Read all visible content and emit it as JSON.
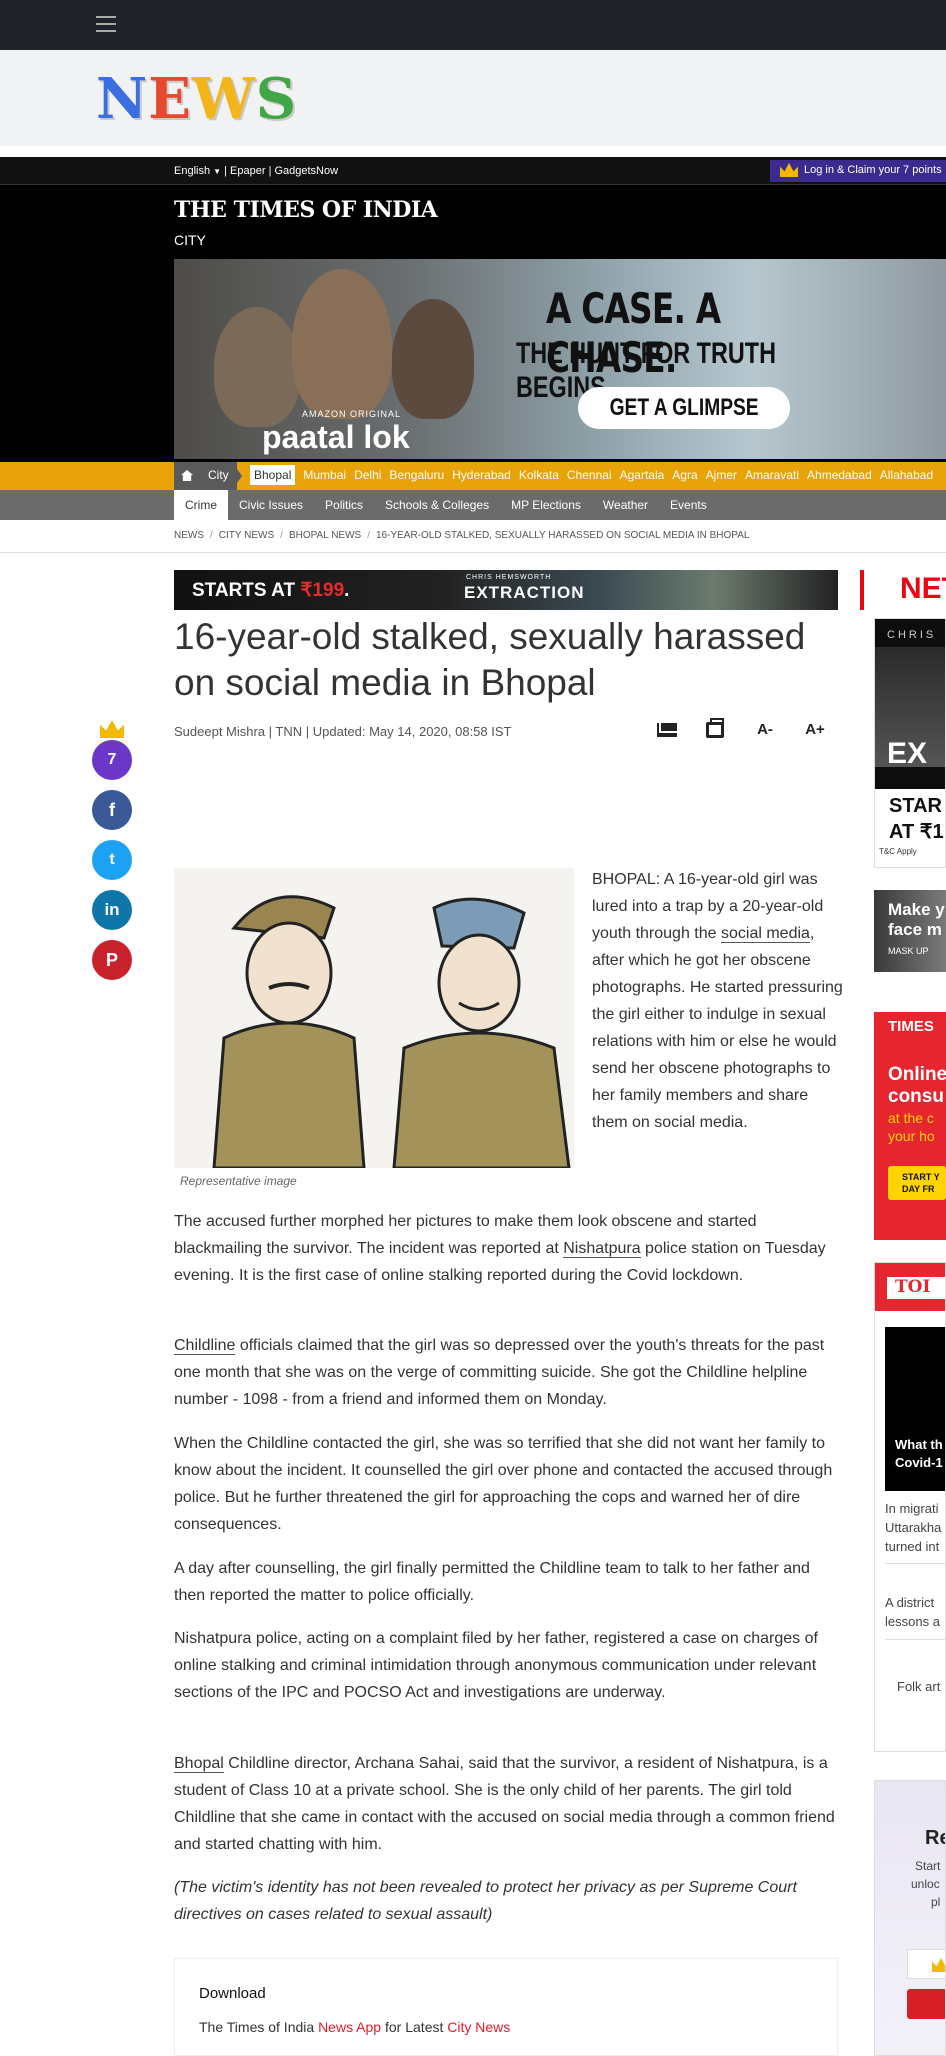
{
  "news_logo": {
    "n": "N",
    "e": "E",
    "w": "W",
    "s": "S"
  },
  "toi_header": {
    "language": "English",
    "links": "| Epaper | GadgetsNow",
    "login": "Log in & Claim your 7 points",
    "brand": "THE TIMES OF INDIA",
    "section": "CITY"
  },
  "banner": {
    "amazon": "AMAZON ORIGINAL",
    "show": "paatal lok",
    "headline": "A CASE. A CHASE.",
    "subhead": "THE HUNT FOR TRUTH BEGINS",
    "cta": "GET A GLIMPSE"
  },
  "city_nav": {
    "label": "City",
    "items": [
      "Bhopal",
      "Mumbai",
      "Delhi",
      "Bengaluru",
      "Hyderabad",
      "Kolkata",
      "Chennai",
      "Agartala",
      "Agra",
      "Ajmer",
      "Amaravati",
      "Ahmedabad",
      "Allahabad"
    ]
  },
  "sub_nav": {
    "items": [
      "Crime",
      "Civic Issues",
      "Politics",
      "Schools & Colleges",
      "MP Elections",
      "Weather",
      "Events"
    ]
  },
  "breadcrumb": [
    "NEWS",
    "CITY NEWS",
    "BHOPAL NEWS",
    "16-YEAR-OLD STALKED, SEXUALLY HARASSED ON SOCIAL MEDIA IN BHOPAL"
  ],
  "ad_strip": {
    "starts": "STARTS AT ",
    "price": "₹199",
    "dot": ".",
    "chris": "CHRIS HEMSWORTH",
    "movie": "EXTRACTION",
    "net": "NET"
  },
  "article": {
    "title": "16-year-old stalked, sexually harassed on social media in Bhopal",
    "byline": "Sudeept Mishra | TNN | Updated: May 14, 2020, 08:58 IST",
    "font_minus": "A-",
    "font_plus": "A+",
    "caption": "Representative image",
    "lead_1": "BHOPAL: A 16-year-old girl was lured into a trap by a 20-year-old youth through the ",
    "lead_link": "social media",
    "lead_2": ", after which he got her obscene photographs. He started pressuring the girl either to indulge in sexual relations with him or else he would send her obscene photographs to her family members and share them on social media.",
    "p1_a": "The accused further morphed her pictures to make them look obscene and started blackmailing the survivor. The incident was reported at ",
    "p1_link": "Nishatpura",
    "p1_b": " police station on Tuesday evening. It is the first case of online stalking reported during the Covid lockdown.",
    "p2_link": "Childline",
    "p2": " officials claimed that the girl was so depressed over the youth's threats for the past one month that she was on the verge of committing suicide. She got the Childline helpline number - 1098 - from a friend and informed them on Monday.",
    "p3": "When the Childline contacted the girl, she was so terrified that she did not want her family to know about the incident. It counselled the girl over phone and contacted the accused through police. But he further threatened the girl for approaching the cops and warned her of dire consequences.",
    "p4": "A day after counselling, the girl finally permitted the Childline team to talk to her father and then reported the matter to police officially.",
    "p5": "Nishatpura police, acting on a complaint filed by her father, registered a case on charges of online stalking and criminal intimidation through anonymous communication under relevant sections of the IPC and POCSO Act and investigations are underway.",
    "p6_link": "Bhopal",
    "p6": " Childline director, Archana Sahai, said that the survivor, a resident of Nishatpura, is a student of Class 10 at a private school. She is the only child of her parents. The girl told Childline that she came in contact with the accused on social media through a common friend and started chatting with him.",
    "p7": "(The victim's identity has not been revealed to protect her privacy as per Supreme Court directives on cases related to sexual assault)"
  },
  "social": {
    "points": "7",
    "facebook": "f",
    "twitter": "t",
    "linkedin": "in",
    "pinterest": "P"
  },
  "download": {
    "heading": "Download",
    "text_1": "The Times of India ",
    "app": "News App",
    "text_2": " for Latest ",
    "city": "City News"
  },
  "right_col": {
    "ad1_chris": "CHRIS",
    "ad1_ex": "EX",
    "ad1_start": "STAR",
    "ad1_at": "AT ₹1",
    "ad1_tc": "T&C Apply",
    "ad2_make": "Make y",
    "ad2_face": "face m",
    "ad2_mask": "MASK UP",
    "ad3_times": "TIMES",
    "ad3_online": "Online",
    "ad3_consu": "consu",
    "ad3_at": "at the c",
    "ad3_your": "your ho",
    "ad3_start": "START Y",
    "ad3_day": "DAY FR",
    "toi_label": "TOI",
    "what": "What th",
    "covid": "Covid-1",
    "story1_a": "In migrati",
    "story1_b": "Uttarakha",
    "story1_c": "turned int",
    "story2_a": "A district",
    "story2_b": "lessons a",
    "story3": "Folk art",
    "re": "Re",
    "start": "Start",
    "unlo": "unloc",
    "pl": "pl"
  },
  "colors": {
    "accent_red": "#e11d2a",
    "city_nav": "#e8a20a",
    "subnav": "#6b6b6b",
    "facebook": "#3b5998",
    "twitter": "#1da1f2",
    "linkedin": "#0e76a8",
    "pinterest": "#c8232c",
    "points": "#6a37c9"
  }
}
